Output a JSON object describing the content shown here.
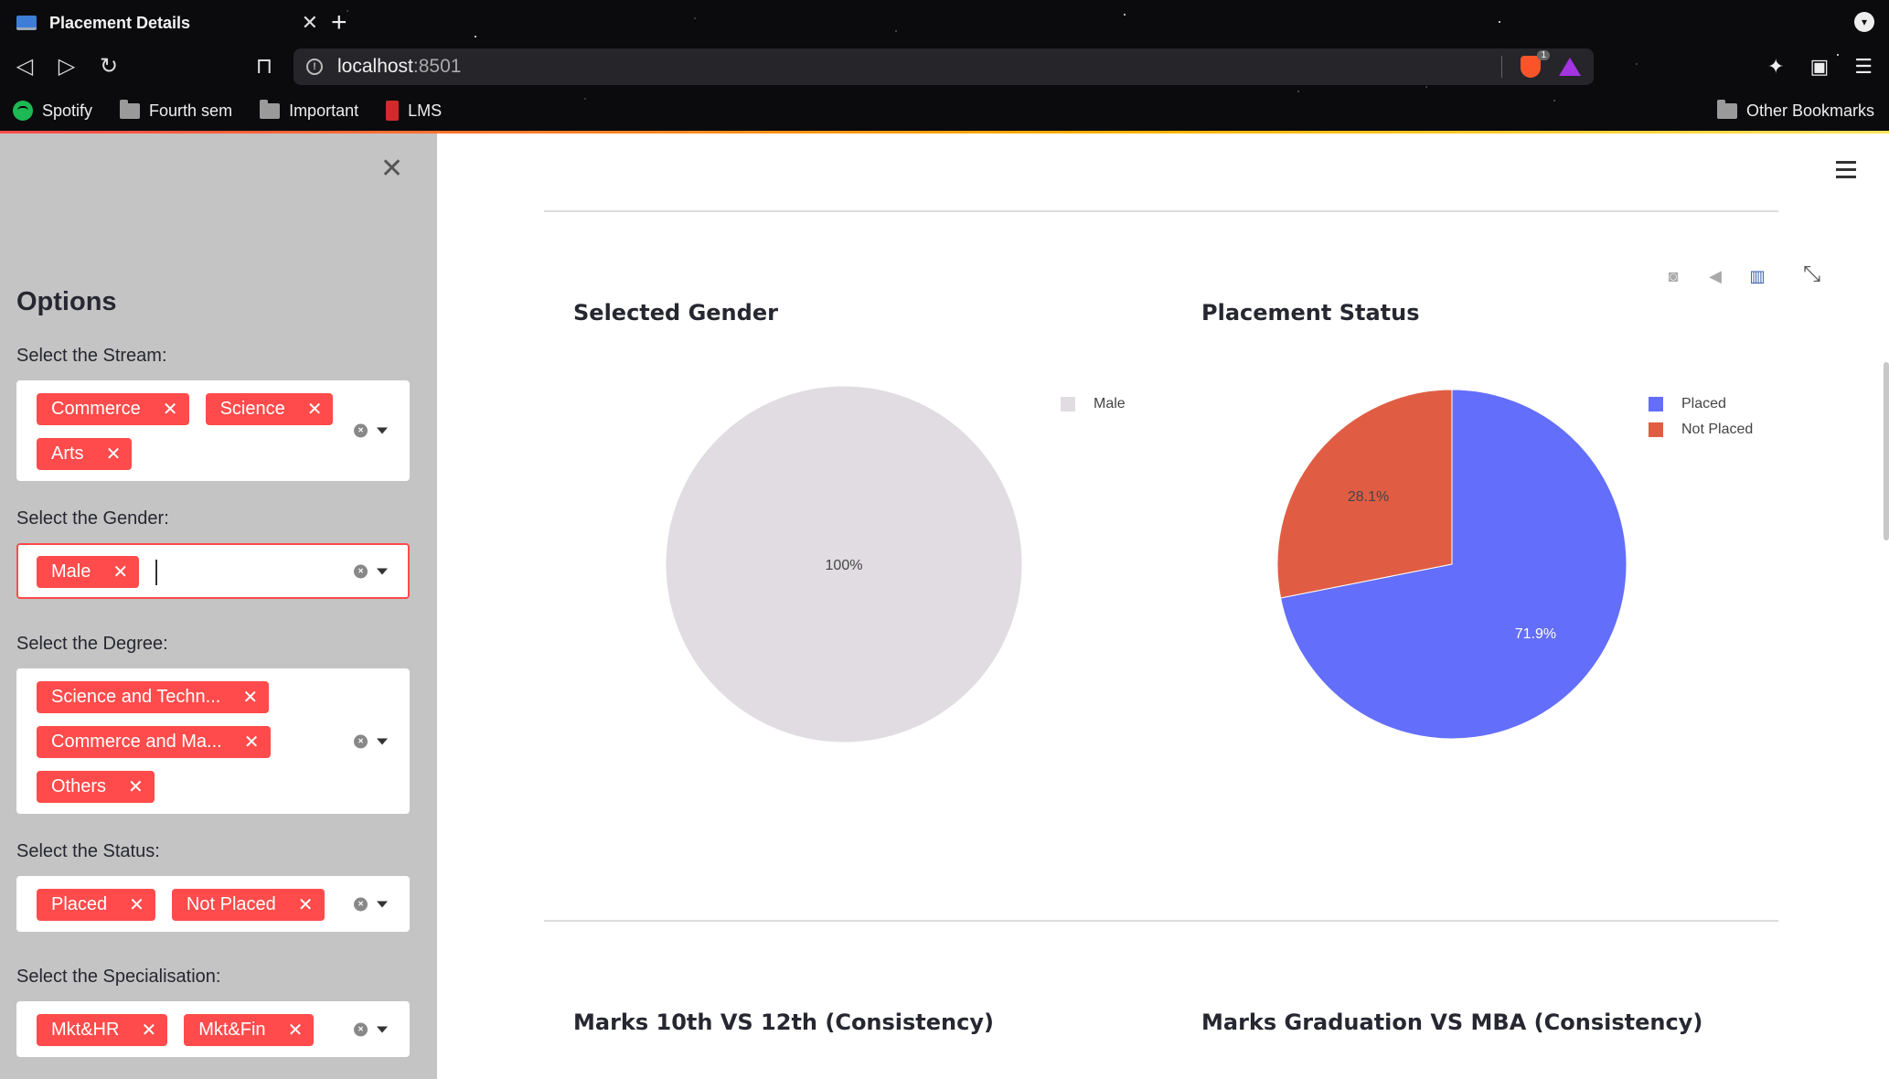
{
  "browser": {
    "tab_title": "Placement Details",
    "url_host": "localhost",
    "url_port": ":8501",
    "brave_badge": "1",
    "bookmarks": [
      {
        "label": "Spotify",
        "icon": "spotify-icon"
      },
      {
        "label": "Fourth sem",
        "icon": "folder-icon"
      },
      {
        "label": "Important",
        "icon": "folder-icon"
      },
      {
        "label": "LMS",
        "icon": "lms-icon"
      }
    ],
    "other_bookmarks": "Other Bookmarks"
  },
  "sidebar": {
    "title": "Options",
    "filters": [
      {
        "label": "Select the Stream:",
        "chips": [
          "Commerce",
          "Science",
          "Arts"
        ],
        "focused": false
      },
      {
        "label": "Select the Gender:",
        "chips": [
          "Male"
        ],
        "focused": true
      },
      {
        "label": "Select the Degree:",
        "chips": [
          "Science and Techn...",
          "Commerce and Ma...",
          "Others"
        ],
        "focused": false
      },
      {
        "label": "Select the Status:",
        "chips": [
          "Placed",
          "Not Placed"
        ],
        "focused": false
      },
      {
        "label": "Select the Specialisation:",
        "chips": [
          "Mkt&HR",
          "Mkt&Fin"
        ],
        "focused": false
      }
    ],
    "chip_color": "#ff4b4b",
    "bg_color": "#c4c4c4"
  },
  "main": {
    "titles": {
      "gender": "Selected Gender",
      "status": "Placement Status",
      "marks1": "Marks 10th VS 12th (Consistency)",
      "marks2": "Marks Graduation VS MBA (Consistency)"
    }
  },
  "chart_data": [
    {
      "type": "pie",
      "title": "Selected Gender",
      "categories": [
        "Male"
      ],
      "values": [
        100
      ],
      "labels": [
        "100%"
      ],
      "colors": [
        "#e0dce1"
      ],
      "legend": "top-right"
    },
    {
      "type": "pie",
      "title": "Placement Status",
      "categories": [
        "Placed",
        "Not Placed"
      ],
      "values": [
        71.9,
        28.1
      ],
      "labels": [
        "71.9%",
        "28.1%"
      ],
      "colors": [
        "#636efa",
        "#e05d44"
      ],
      "legend": "top-right"
    }
  ]
}
